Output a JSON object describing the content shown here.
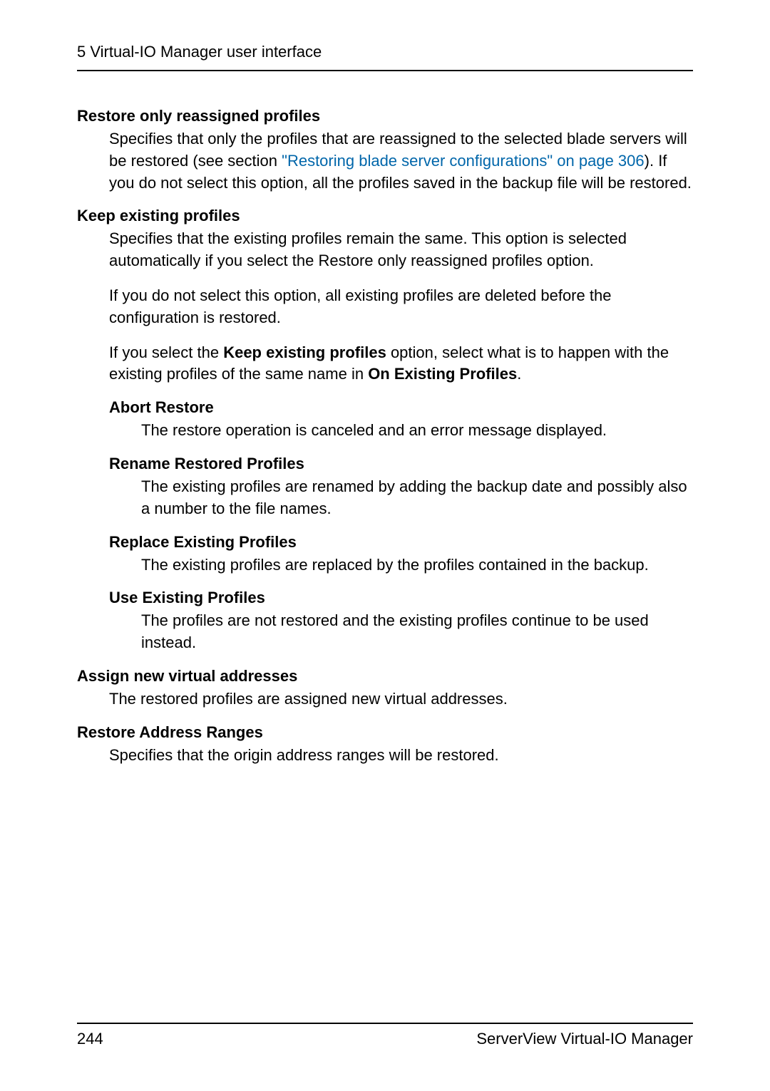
{
  "header": {
    "text": "5 Virtual-IO Manager user interface"
  },
  "sections": {
    "restoreOnly": {
      "title": "Restore only reassigned profiles",
      "body_pre": "Specifies that only the profiles that are reassigned to the selected blade servers will be restored (see section ",
      "link": "\"Restoring blade server configurations\" on page 306",
      "body_post": "). If you do not select this option, all the profiles saved in the backup file will be restored."
    },
    "keepExisting": {
      "title": "Keep existing profiles",
      "p1": "Specifies that the existing profiles remain the same. This option is selected automatically if you select the Restore only reassigned profiles option.",
      "p2": "If you do not select this option, all existing profiles are deleted before the configuration is restored.",
      "p3_pre": "If you select the ",
      "p3_bold1": "Keep existing profiles",
      "p3_mid": " option, select what is to happen with the existing profiles of the same name in ",
      "p3_bold2": "On Existing Profiles",
      "p3_post": "."
    },
    "abortRestore": {
      "title": "Abort Restore",
      "body": "The restore operation is canceled and an error message displayed."
    },
    "renameRestored": {
      "title": "Rename Restored Profiles",
      "body": "The existing profiles are renamed by adding the backup date and possibly also a number to the file names."
    },
    "replaceExisting": {
      "title": "Replace Existing Profiles",
      "body": "The existing profiles are replaced by the profiles contained in the backup."
    },
    "useExisting": {
      "title": "Use Existing Profiles",
      "body": "The profiles are not restored and the existing profiles continue to be used instead."
    },
    "assignNew": {
      "title": "Assign new virtual addresses",
      "body": "The restored profiles are assigned new virtual addresses."
    },
    "restoreAddress": {
      "title": "Restore Address Ranges",
      "body": "Specifies that the origin address ranges will be restored."
    }
  },
  "footer": {
    "page": "244",
    "product": "ServerView Virtual-IO Manager"
  }
}
